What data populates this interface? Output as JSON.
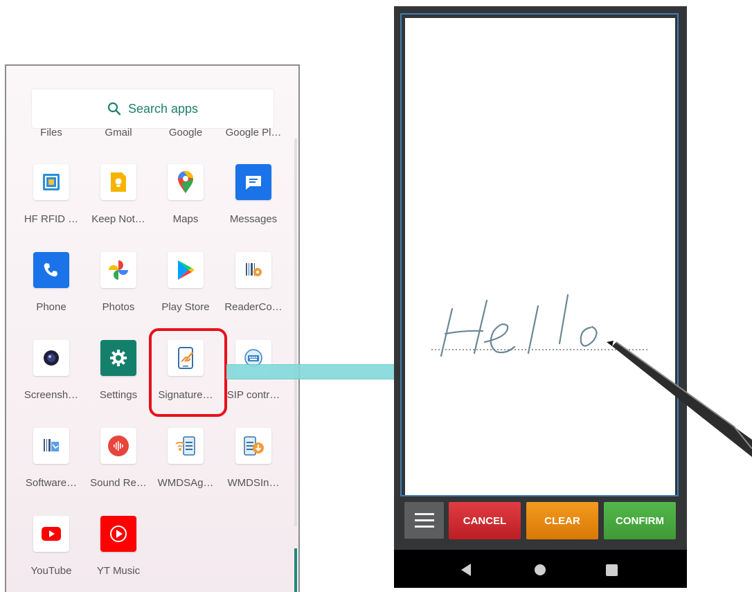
{
  "drawer": {
    "search_placeholder": "Search apps",
    "partial_row": [
      "Files",
      "Gmail",
      "Google",
      "Google Pl…"
    ],
    "apps": [
      {
        "name": "HF RFID …",
        "icon": "hf-rfid-icon"
      },
      {
        "name": "Keep Not…",
        "icon": "keep-notes-icon"
      },
      {
        "name": "Maps",
        "icon": "maps-pin-icon"
      },
      {
        "name": "Messages",
        "icon": "messages-icon"
      },
      {
        "name": "Phone",
        "icon": "phone-icon"
      },
      {
        "name": "Photos",
        "icon": "photos-pinwheel-icon"
      },
      {
        "name": "Play Store",
        "icon": "play-store-icon"
      },
      {
        "name": "ReaderCo…",
        "icon": "reader-config-icon"
      },
      {
        "name": "Screensh…",
        "icon": "screenshot-icon"
      },
      {
        "name": "Settings",
        "icon": "settings-gear-icon"
      },
      {
        "name": "Signature…",
        "icon": "signature-pad-icon"
      },
      {
        "name": "SIP contr…",
        "icon": "sip-keyboard-icon"
      },
      {
        "name": "Software…",
        "icon": "software-barcode-icon"
      },
      {
        "name": "Sound Re…",
        "icon": "sound-recorder-icon"
      },
      {
        "name": "WMDSAg…",
        "icon": "wmds-agent-icon"
      },
      {
        "name": "WMDSIn…",
        "icon": "wmds-installer-icon"
      },
      {
        "name": "YouTube",
        "icon": "youtube-icon"
      },
      {
        "name": "YT Music",
        "icon": "yt-music-icon"
      }
    ]
  },
  "signature": {
    "handwriting": "Hello",
    "buttons": {
      "cancel": "CANCEL",
      "clear": "CLEAR",
      "confirm": "CONFIRM"
    }
  },
  "colors": {
    "highlight": "#e8101a",
    "arrow": "#82d9da",
    "cancel": "#d3292f",
    "clear": "#ec8c14",
    "confirm": "#4aae42"
  }
}
